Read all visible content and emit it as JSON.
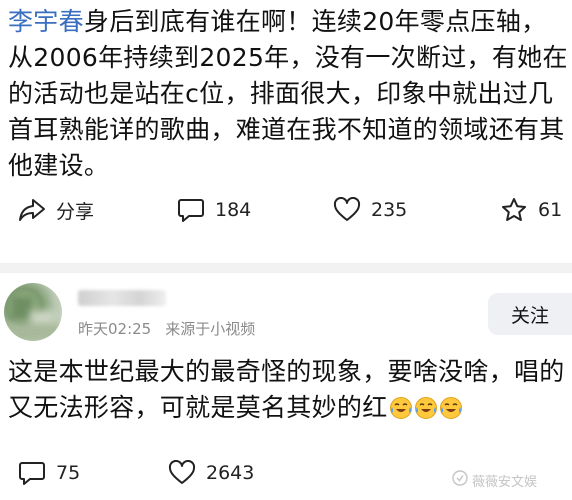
{
  "post": {
    "author": "李宇春",
    "body": "身后到底有谁在啊！连续20年零点压轴，从2006年持续到2025年，没有一次断过，有她在的活动也是站在c位，排面很大，印象中就出过几首耳熟能详的歌曲，难道在我不知道的领域还有其他建设。",
    "actions": {
      "share_label": "分享",
      "comments": "184",
      "likes": "235",
      "favorites": "61"
    }
  },
  "reply": {
    "time": "昨天02:25",
    "source": "来源于小视频",
    "follow_label": "关注",
    "body": "这是本世纪最大的最奇怪的现象，要啥没啥，唱的又无法形容，可就是莫名其妙的红",
    "emojis": [
      "crying-laughing-emoji",
      "crying-laughing-emoji",
      "crying-laughing-emoji"
    ],
    "actions": {
      "comments": "75",
      "likes": "2643"
    }
  },
  "watermark": "薇薇安文娱",
  "colors": {
    "link": "#3a6fbf",
    "divider": "#f2f2f2",
    "meta": "#8a8a8a",
    "follow_bg": "#eef0f4"
  }
}
